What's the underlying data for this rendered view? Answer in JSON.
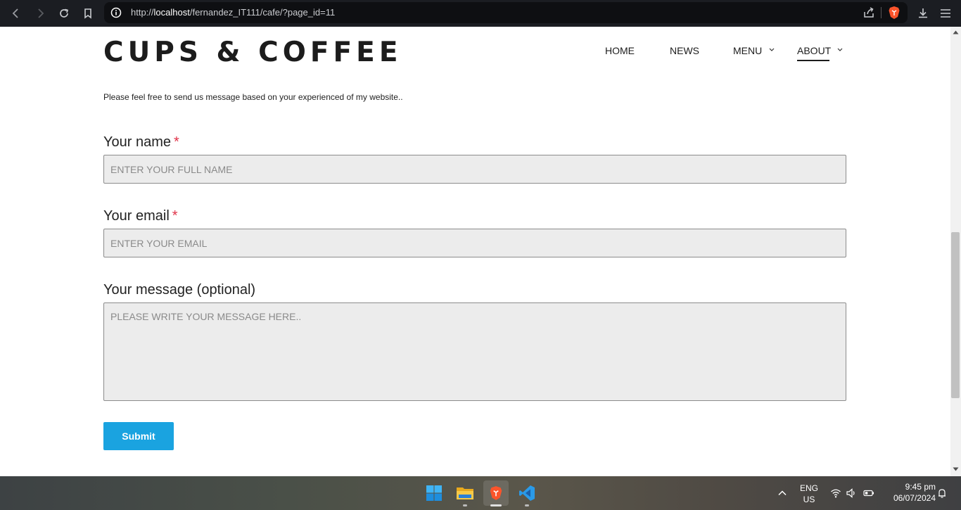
{
  "browser": {
    "url_prefix": "http://",
    "url_host": "localhost",
    "url_path": "/fernandez_IT111/cafe/?page_id=11"
  },
  "site": {
    "logo": "CUPS & COFFEE",
    "nav": {
      "home": "HOME",
      "news": "NEWS",
      "menu": "MENU",
      "about": "ABOUT"
    },
    "active_nav": "ABOUT"
  },
  "form": {
    "intro": "Please feel free to send us message based on your experienced of my website..",
    "name_label": "Your name",
    "name_placeholder": "ENTER YOUR FULL NAME",
    "email_label": "Your email",
    "email_placeholder": "ENTER YOUR EMAIL",
    "message_label": "Your message (optional)",
    "message_placeholder": "PLEASE WRITE YOUR MESSAGE HERE..",
    "required_mark": "*",
    "submit_label": "Submit"
  },
  "taskbar": {
    "lang_line1": "ENG",
    "lang_line2": "US",
    "time": "9:45 pm",
    "date": "06/07/2024",
    "apps": [
      "start-icon",
      "file-explorer-icon",
      "brave-browser-icon",
      "vscode-icon"
    ]
  },
  "colors": {
    "accent": "#1aa3e0",
    "required": "#e0344a",
    "field_bg": "#ececec",
    "browser_bar": "#1b1d22"
  }
}
